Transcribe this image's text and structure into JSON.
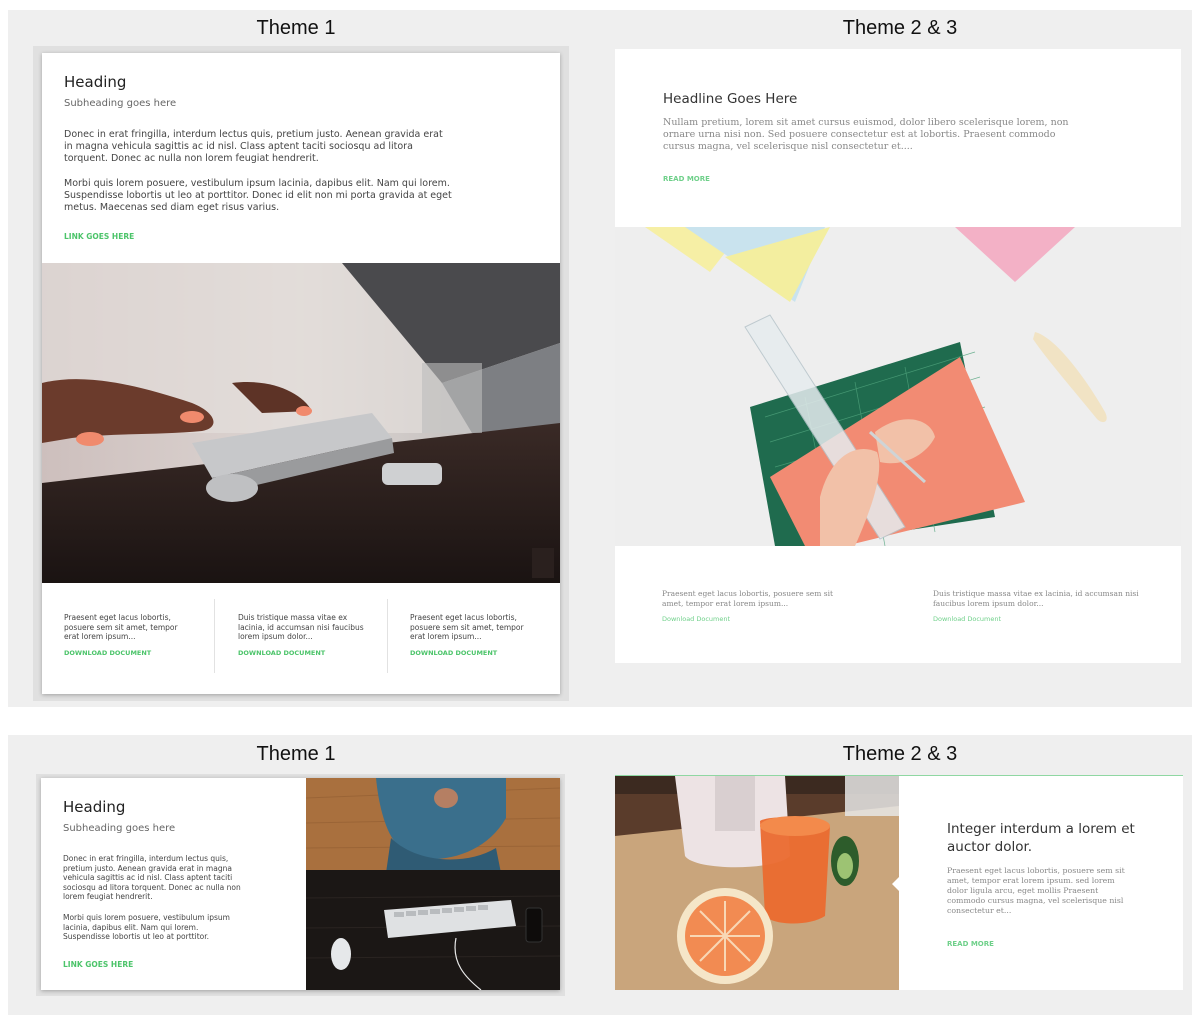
{
  "labels": {
    "top_left": "Theme 1",
    "top_right": "Theme 2 & 3",
    "bottom_left": "Theme 1",
    "bottom_right": "Theme 2 & 3"
  },
  "t1_top": {
    "heading": "Heading",
    "subheading": "Subheading goes here",
    "para1": "Donec in erat fringilla, interdum lectus quis, pretium justo. Aenean gravida erat in magna vehicula sagittis ac id nisl. Class aptent taciti sociosqu ad litora torquent. Donec ac nulla non lorem feugiat hendrerit.",
    "para2": "Morbi quis lorem posuere, vestibulum ipsum lacinia, dapibus elit. Nam qui lorem. Suspendisse lobortis ut leo at porttitor. Donec id elit non mi porta gravida at eget metus. Maecenas sed diam eget risus varius.",
    "link": "LINK GOES HERE",
    "columns": [
      {
        "text": "Praesent eget lacus lobortis, posuere sem sit amet, tempor erat lorem ipsum...",
        "link": "DOWNLOAD DOCUMENT"
      },
      {
        "text": "Duis tristique massa vitae ex lacinia, id accumsan nisi faucibus lorem ipsum dolor...",
        "link": "DOWNLOAD DOCUMENT"
      },
      {
        "text": "Praesent eget lacus lobortis, posuere sem sit amet, tempor erat lorem ipsum...",
        "link": "DOWNLOAD DOCUMENT"
      }
    ]
  },
  "t23_top": {
    "headline": "Headline Goes Here",
    "body": "Nullam pretium, lorem sit amet cursus euismod, dolor libero scelerisque lorem, non ornare urna nisi non. Sed posuere consectetur est at lobortis. Praesent commodo cursus magna, vel scelerisque nisl consectetur et....",
    "read_more": "READ MORE",
    "columns": [
      {
        "text": "Praesent eget lacus lobortis, posuere sem sit amet, tempor erat lorem ipsum...",
        "link": "Download Document"
      },
      {
        "text": "Duis tristique massa vitae ex lacinia, id accumsan nisi faucibus lorem ipsum dolor...",
        "link": "Download Document"
      }
    ]
  },
  "t1_bottom": {
    "heading": "Heading",
    "subheading": "Subheading goes here",
    "para1": "Donec in erat fringilla, interdum lectus quis, pretium justo. Aenean gravida erat in magna vehicula sagittis ac id nisl. Class aptent taciti sociosqu ad litora torquent. Donec ac nulla non lorem feugiat hendrerit.",
    "para2": "Morbi quis lorem posuere, vestibulum ipsum lacinia, dapibus elit. Nam qui lorem. Suspendisse lobortis ut leo at porttitor.",
    "link": "LINK GOES HERE"
  },
  "t23_bottom": {
    "headline": "Integer interdum a lorem et auctor dolor.",
    "body": "Praesent eget lacus lobortis, posuere sem sit amet, tempor erat lorem ipsum. sed lorem dolor ligula arcu, eget mollis Praesent commodo cursus magna, vel scelerisque nisl consectetur et...",
    "read_more": "READ MORE"
  },
  "colors": {
    "accent_green": "#4cc46a",
    "panel_bg": "#efefef"
  },
  "images": [
    "typing-keyboard-photo",
    "cutting-mat-photo",
    "desk-keyboard-photo",
    "juice-photo"
  ]
}
